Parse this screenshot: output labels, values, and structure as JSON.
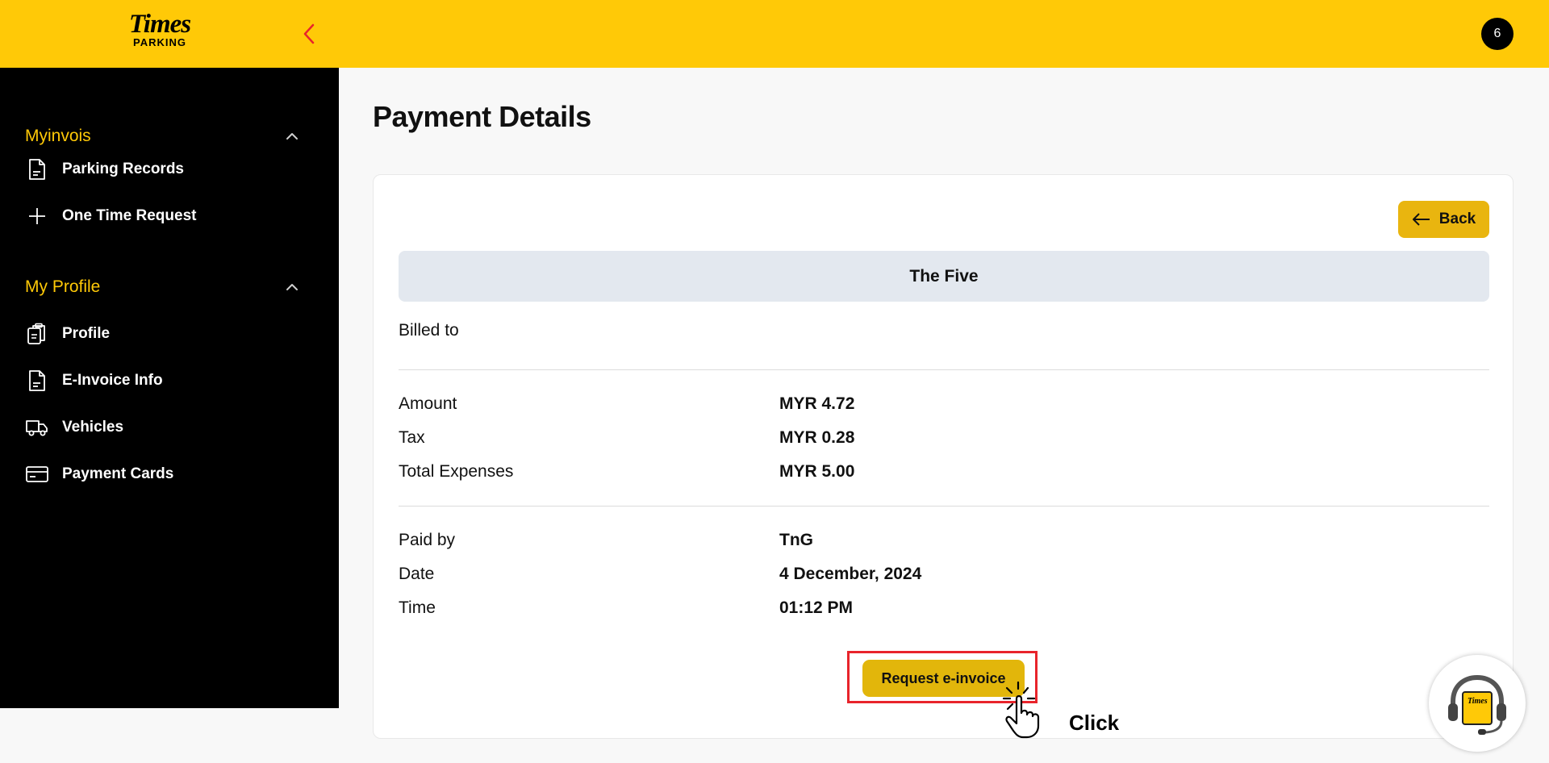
{
  "header": {
    "logo_main": "Times",
    "logo_sub": "PARKING",
    "notification_count": "6"
  },
  "sidebar": {
    "sections": [
      {
        "title": "Myinvois",
        "items": [
          {
            "label": "Parking Records",
            "icon": "document-icon"
          },
          {
            "label": "One Time Request",
            "icon": "plus-icon"
          }
        ]
      },
      {
        "title": "My Profile",
        "items": [
          {
            "label": "Profile",
            "icon": "clipboard-icon"
          },
          {
            "label": "E-Invoice Info",
            "icon": "document-icon"
          },
          {
            "label": "Vehicles",
            "icon": "truck-icon"
          },
          {
            "label": "Payment Cards",
            "icon": "credit-card-icon"
          }
        ]
      }
    ]
  },
  "main": {
    "page_title": "Payment Details",
    "back_label": "Back",
    "location": "The Five",
    "billed_to_label": "Billed to",
    "charges": [
      {
        "label": "Amount",
        "value": "MYR 4.72"
      },
      {
        "label": "Tax",
        "value": "MYR 0.28"
      },
      {
        "label": "Total Expenses",
        "value": "MYR 5.00"
      }
    ],
    "payment": [
      {
        "label": "Paid by",
        "value": "TnG"
      },
      {
        "label": "Date",
        "value": "4 December, 2024"
      },
      {
        "label": "Time",
        "value": "01:12 PM"
      }
    ],
    "request_button": "Request e-invoice"
  },
  "annotation": {
    "click_label": "Click"
  },
  "support_widget": {
    "logo_text": "Times"
  },
  "colors": {
    "brand_yellow": "#ffc907",
    "button_yellow": "#e2b60b",
    "sidebar_bg": "#000000",
    "highlight_red": "#e8242b",
    "location_bg": "#e3e8ef"
  }
}
